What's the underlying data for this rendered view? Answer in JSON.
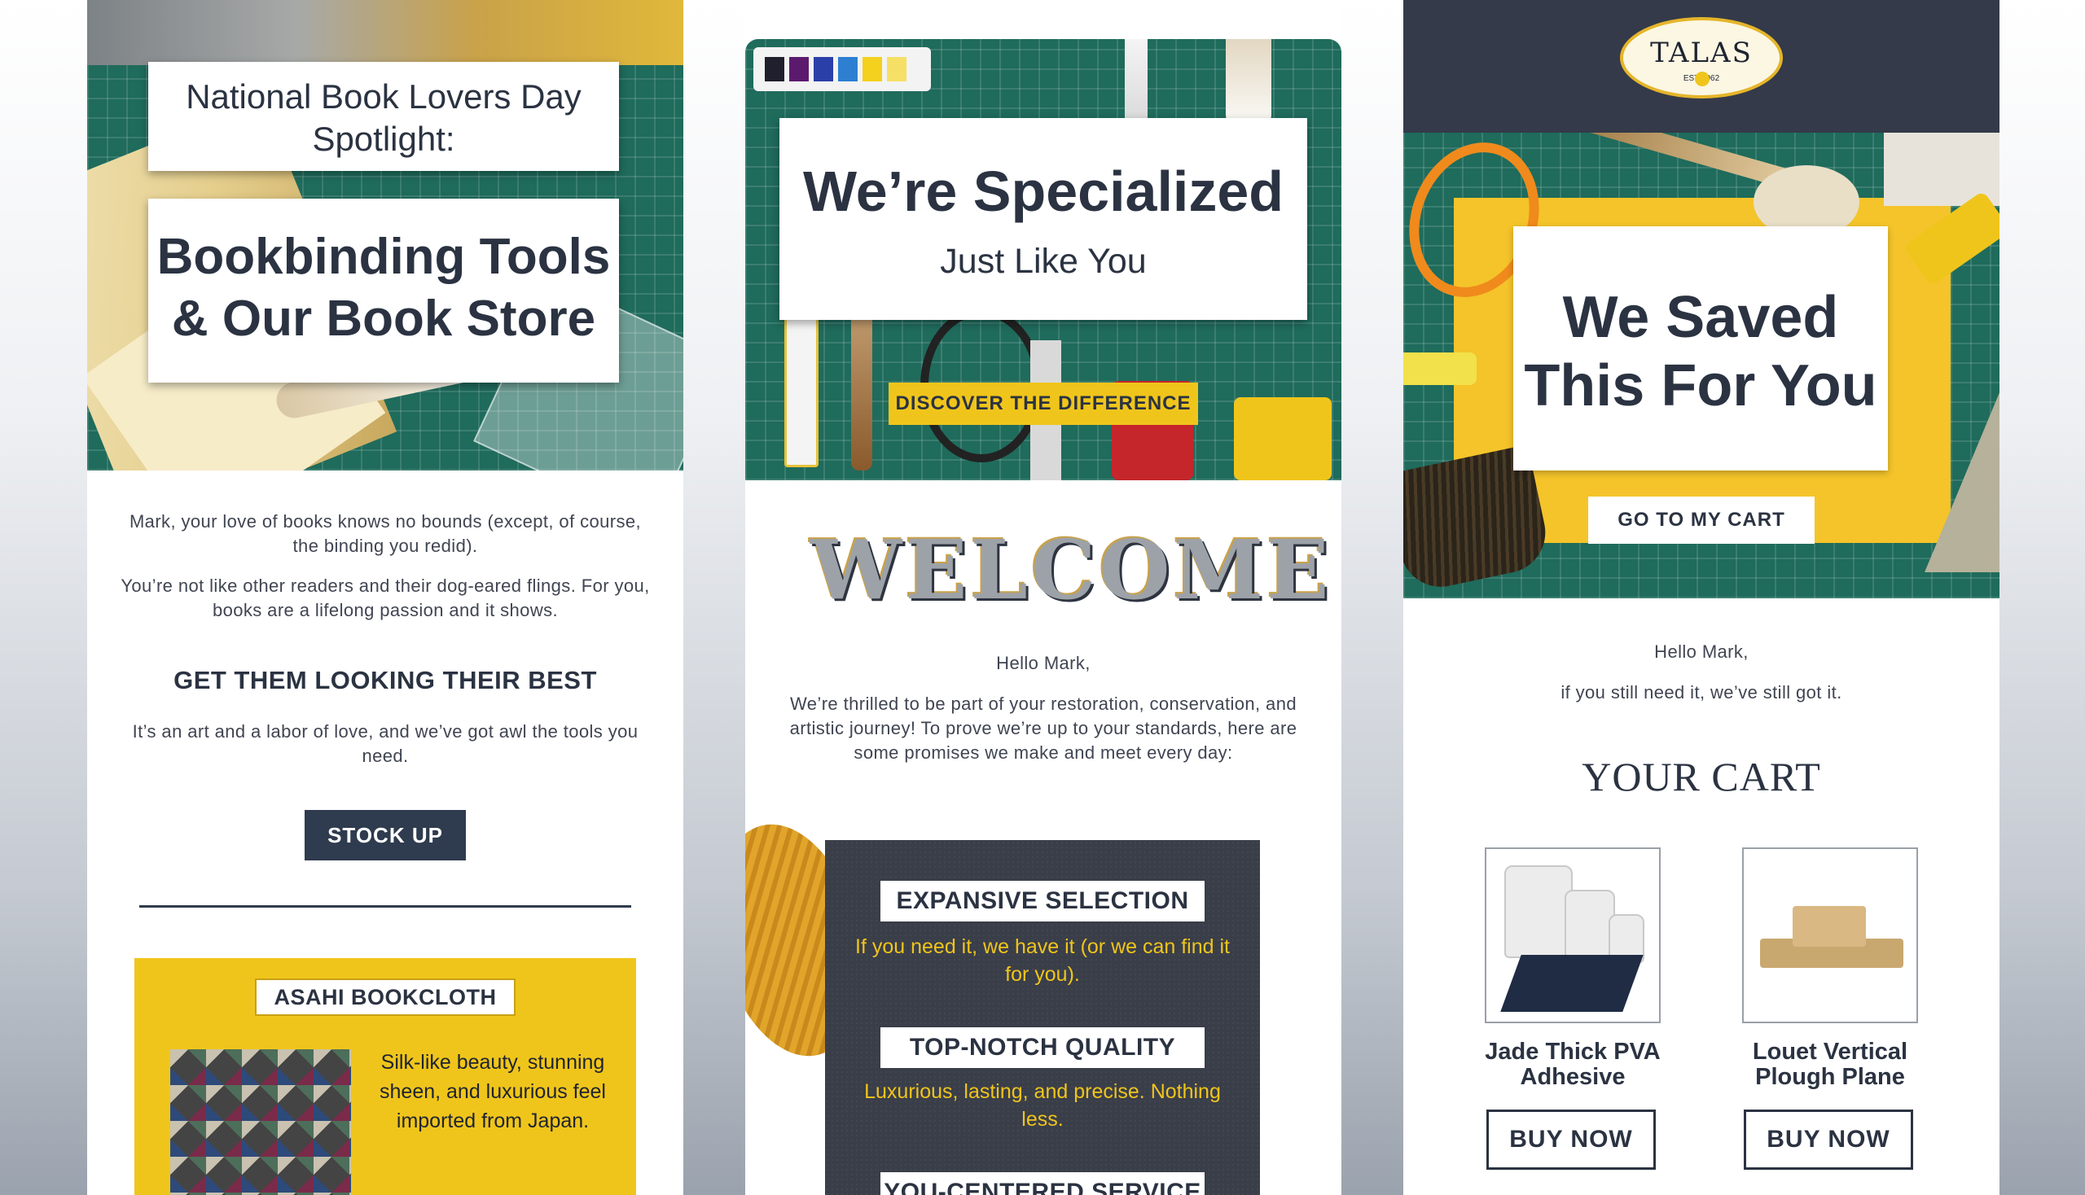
{
  "panel1": {
    "spotlight_title": "National Book Lovers Day Spotlight:",
    "main_title": "Bookbinding Tools & Our Book Store",
    "greeting_1": "Mark, your love of books knows no bounds (except, of course, the binding you redid).",
    "greeting_2": "You’re not like other readers and their dog-eared flings. For you, books are a lifelong passion and it shows.",
    "section_heading": "GET THEM LOOKING THEIR BEST",
    "section_text": "It’s an art and a labor of love, and we’ve got awl the tools you need.",
    "button_label": "STOCK UP",
    "promo": {
      "title": "ASAHI BOOKCLOTH",
      "text": "Silk-like beauty, stunning sheen, and luxurious feel imported from Japan.",
      "background_color": "#f0c51b"
    }
  },
  "panel2": {
    "title": "We’re Specialized",
    "subtitle": "Just Like You",
    "button_label": "DISCOVER THE DIFFERENCE",
    "welcome_art": "WELCOME",
    "hello": "Hello Mark,",
    "intro": "We’re thrilled to be part of your restoration, conservation, and artistic journey! To prove we’re up to your standards, here are some promises we make and meet every day:",
    "features": [
      {
        "label": "EXPANSIVE SELECTION",
        "desc": "If you need it, we have it (or we can find it for you)."
      },
      {
        "label": "TOP-NOTCH QUALITY",
        "desc": "Luxurious, lasting, and precise. Nothing less."
      },
      {
        "label": "YOU-CENTERED SERVICE",
        "desc": ""
      }
    ],
    "accent_color": "#f0c51b"
  },
  "panel3": {
    "logo_text": "TALAS",
    "logo_est": "EST          1962",
    "title": "We Saved This For You",
    "button_label": "GO TO MY CART",
    "hello": "Hello Mark,",
    "still_text": "if you still need it, we’ve still got it.",
    "cart_heading": "YOUR CART",
    "products": [
      {
        "name": "Jade Thick PVA Adhesive",
        "button": "BUY NOW"
      },
      {
        "name": "Louet Vertical Plough Plane",
        "button": "BUY NOW"
      }
    ],
    "header_color": "#343a49"
  },
  "colors": {
    "navy": "#2b3342",
    "yellow": "#f0c51b",
    "mat_green": "#1f6b5c"
  }
}
